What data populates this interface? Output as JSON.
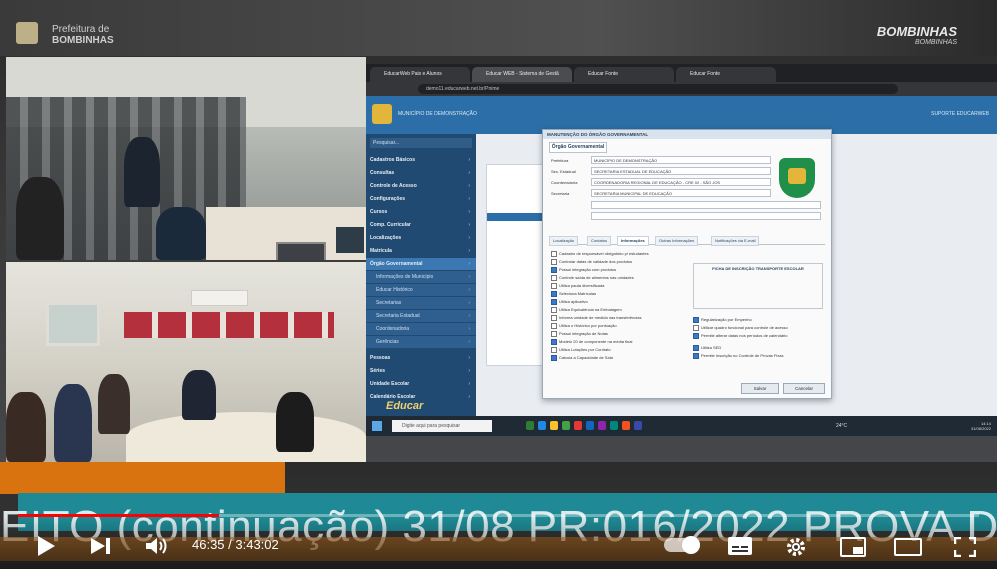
{
  "header": {
    "left_logo_line1": "Prefeitura de",
    "left_logo_line2": "BOMBINHAS",
    "right_logo": "BOMBINHAS",
    "right_logo_sub": "BOMBINHAS"
  },
  "browser": {
    "tabs": [
      "EducarWeb Pais e Alunos",
      "Educar WEB - Sistema de Gestã",
      "Educar Fonte",
      "Educar Fonte"
    ],
    "url": "demo11.educarweb.net.br/Pnime"
  },
  "app": {
    "title": "MUNICÍPIO DE DEMONSTRAÇÃO",
    "user": "SUPORTE EDUCARWEB",
    "sidebar_search": "Pesquisar...",
    "sidebar_items": [
      "Cadastros Básicos",
      "Consultas",
      "Controle de Acesso",
      "Configurações",
      "Cursos",
      "Comp. Curricular",
      "Localizações",
      "Matrícula",
      "Órgão Governamental"
    ],
    "sidebar_subitems": [
      "Informações de Município",
      "Educar Histórico",
      "Secretarias",
      "Secretaria Estadual",
      "Coordenadoria",
      "Gerências"
    ],
    "sidebar_items_bottom": [
      "Pessoas",
      "Séries",
      "Unidade Escolar",
      "Calendário Escolar"
    ],
    "sidebar_logo": "Educar"
  },
  "dialog": {
    "title": "MANUTENÇÃO DO ÓRGÃO GOVERNAMENTAL",
    "tab": "Órgão Governamental",
    "fields": [
      {
        "label": "Prefeitura",
        "value": "MUNICÍPIO DE DEMONSTRAÇÃO"
      },
      {
        "label": "Sec. Estadual",
        "value": "SECRETARIA ESTADUAL DE EDUCAÇÃO"
      },
      {
        "label": "Coordenadoria",
        "value": "COORDENADORIA REGIONAL DE EDUCAÇÃO - CRE 02 - SÃO JOS"
      },
      {
        "label": "Secretaria",
        "value": "SECRETARIA MUNICIPAL DE EDUCAÇÃO"
      }
    ],
    "subtabs": [
      "Localização",
      "Contatos",
      "Informações",
      "Outras Informações",
      "Notificações via E-mail"
    ],
    "checks_left": [
      "Cadastro de responsável obrigatório p/ estudantes",
      "Controlar datas de validade dos produtos",
      "Possui integração com produtos",
      "Controle saída de alimentos nas unidades",
      "Utiliza pauta diversificada",
      "Seleciona Matrículas",
      "Utiliza aplicativo",
      "Utiliza Equivalência na Embalagem",
      "Informa unidade de medida nas transferências",
      "Utiliza o Histórico por pontuação",
      "Possui integração de Notas",
      "Modelo 20 de componente na média final",
      "Utiliza Lotações por Contrato",
      "Calcula a Capacidade de Sala"
    ],
    "box_title": "FICHA DE INSCRIÇÃO TRANSPORTE ESCOLAR",
    "checks_right": [
      "Regularização por Empenho",
      "Utilizar quadro funcional para controle de acesso",
      "Permite alterar datas nos períodos de calendário",
      "Utiliza SED",
      "Permite Inscrição no Controle de Provas Fixas"
    ],
    "save": "Salvar",
    "cancel": "Cancelar"
  },
  "taskbar": {
    "search": "Digite aqui para pesquisar",
    "temp": "24°C",
    "time": "14:14",
    "date": "31/08/2022"
  },
  "overlay": {
    "ticker": "EITO (continuação) 31/08 PR:016/2022 PROVA D"
  },
  "player": {
    "time": "46:35 / 3:43:02",
    "progress": 0.209
  }
}
